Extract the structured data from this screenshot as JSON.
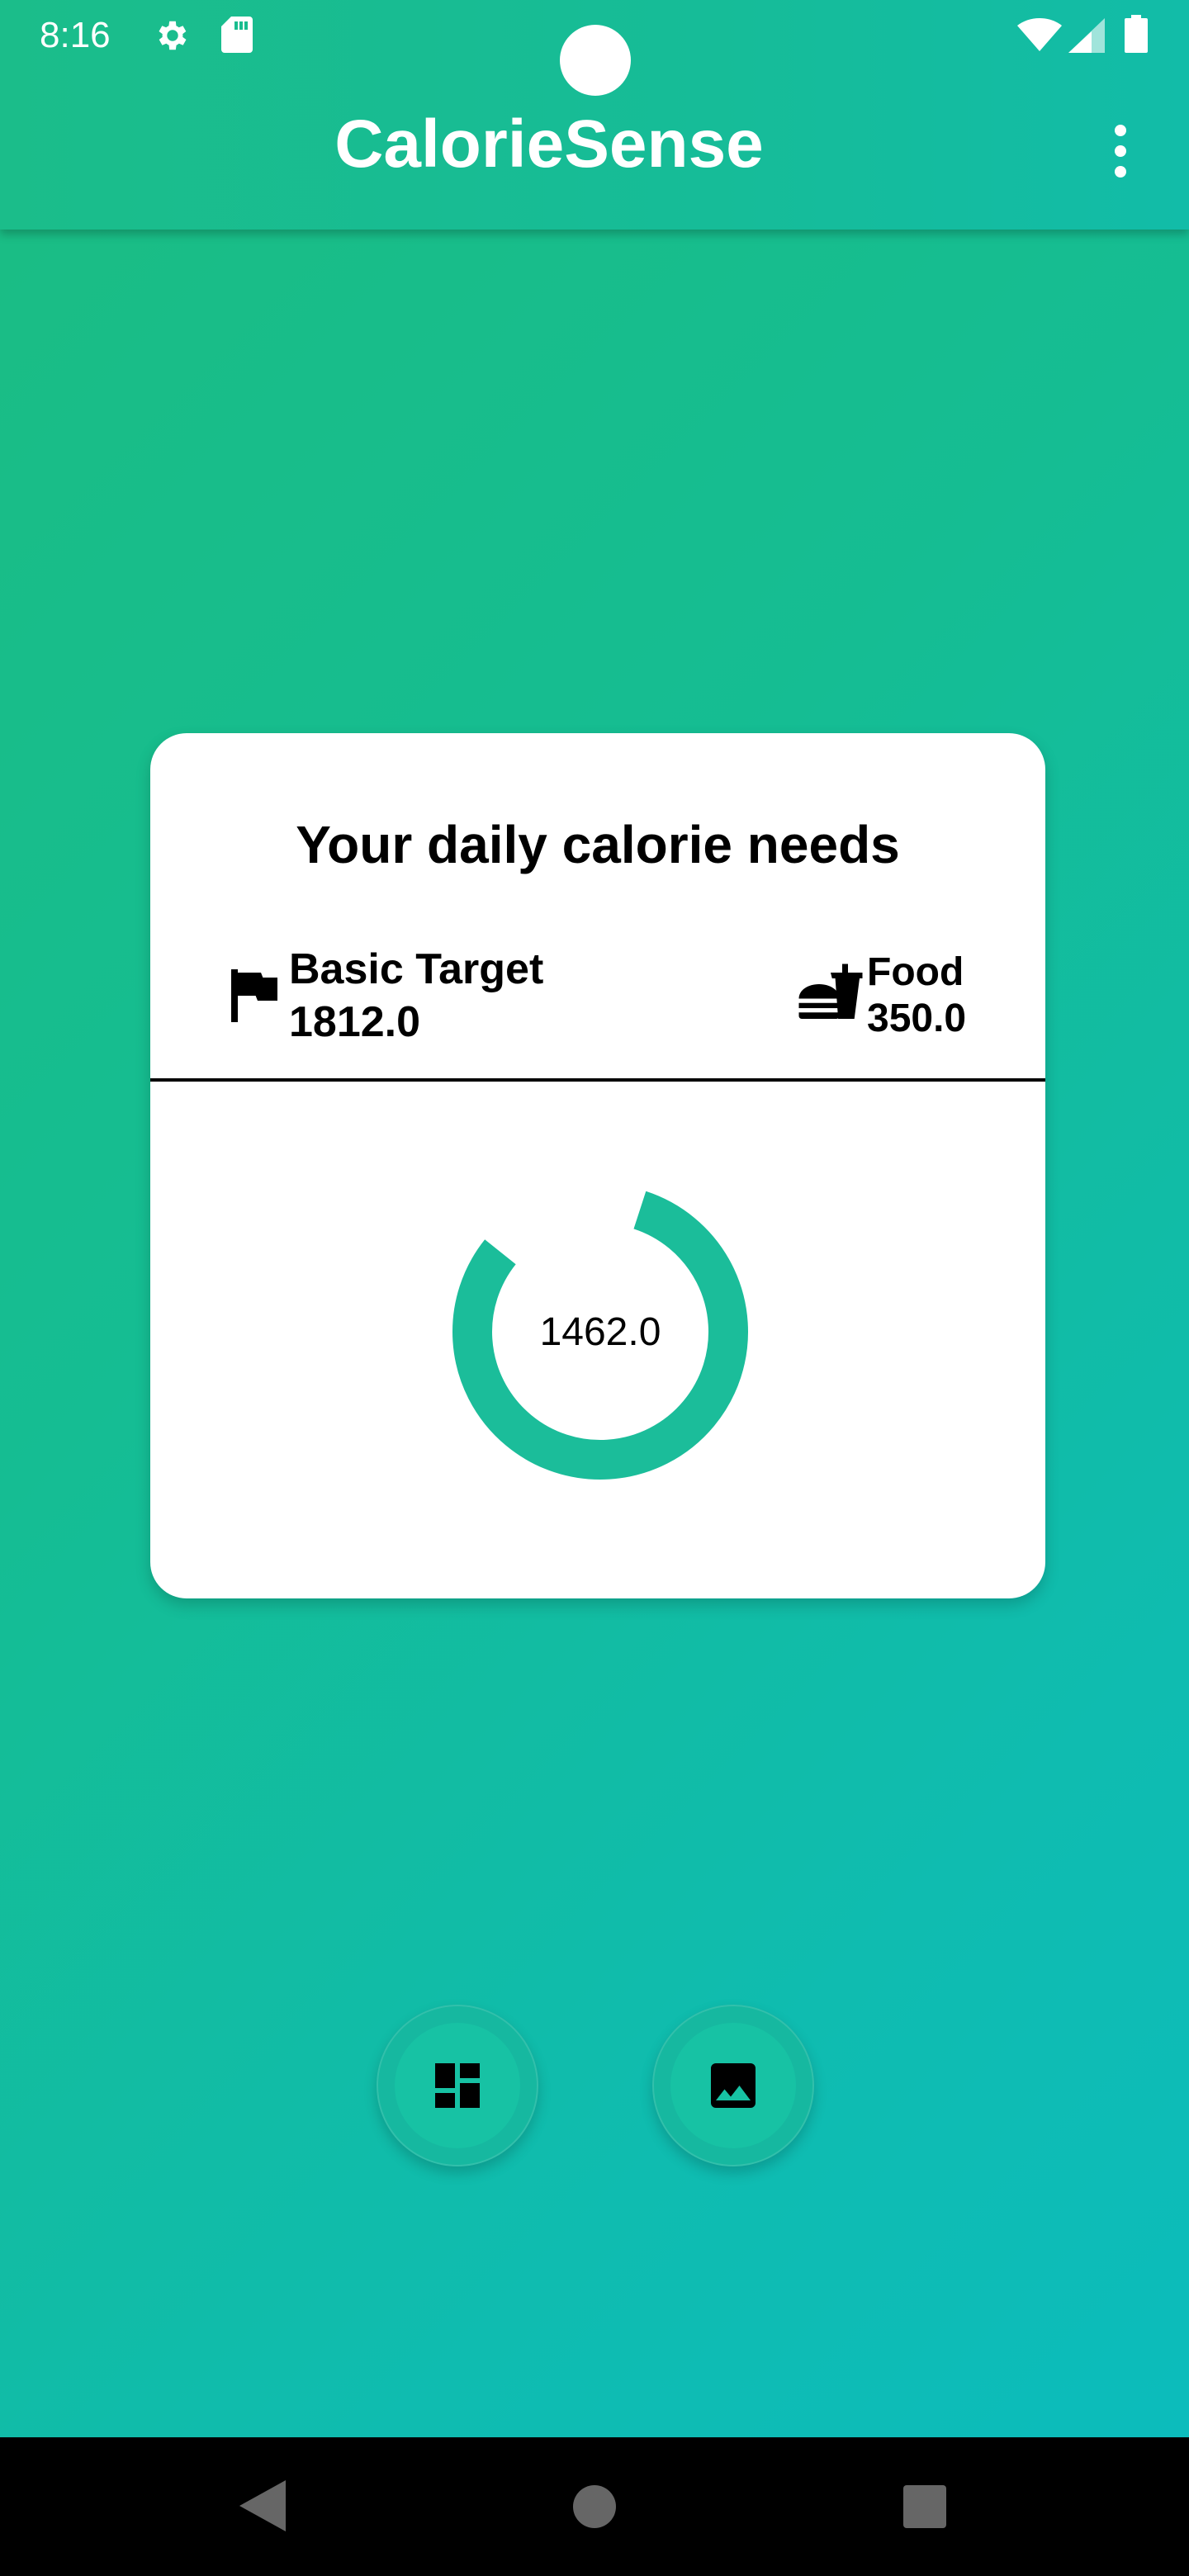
{
  "status_bar": {
    "time": "8:16",
    "icons": [
      "settings-icon",
      "sd-card-icon",
      "wifi-icon",
      "signal-icon",
      "battery-icon"
    ]
  },
  "app_bar": {
    "title": "CalorieSense",
    "menu_icon": "more-vert-icon"
  },
  "card": {
    "title": "Your daily calorie needs",
    "basic_target": {
      "label": "Basic Target",
      "value": "1812.0",
      "icon": "flag-icon"
    },
    "food": {
      "label": "Food",
      "value": "350.0",
      "icon": "fastfood-icon"
    },
    "remaining": {
      "value": "1462.0",
      "fraction": 0.807
    }
  },
  "fabs": [
    {
      "icon": "dashboard-icon"
    },
    {
      "icon": "image-icon"
    }
  ],
  "nav_bar": {
    "icons": [
      "back-icon",
      "home-icon",
      "recents-icon"
    ]
  },
  "colors": {
    "accent": "#1bbd9a",
    "appbar": "#17bc95",
    "background_start": "#1bbd82",
    "background_end": "#0bbcbe"
  }
}
